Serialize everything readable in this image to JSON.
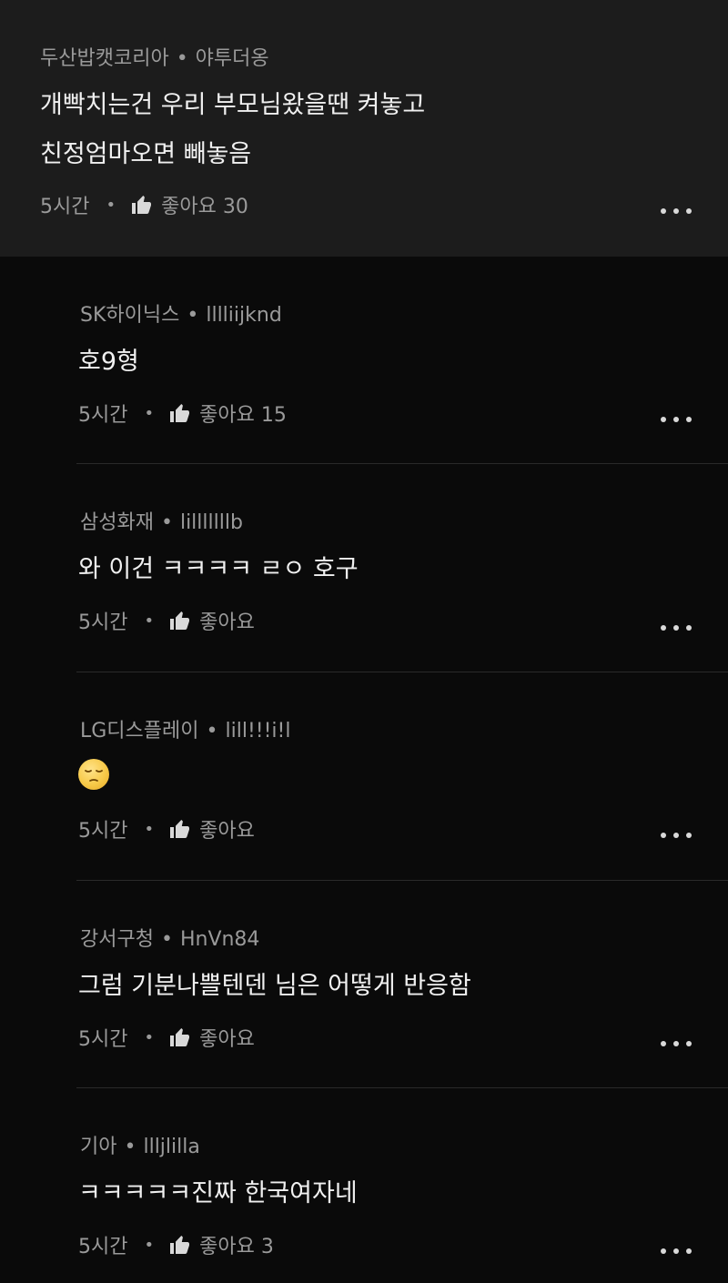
{
  "comments": [
    {
      "author": "두산밥캣코리아",
      "nickname": "야투더옹",
      "separator": "•",
      "lines": [
        "개빡치는건 우리 부모님왔을땐 켜놓고",
        "친정엄마오면 빼놓음"
      ],
      "time": "5시간",
      "footer_sep": "•",
      "like_label": "좋아요 30",
      "like_icon": "thumbs-up-icon",
      "more_icon": "more-dots-icon"
    }
  ],
  "replies": [
    {
      "author": "SK하이닉스",
      "nickname": "lllliijknd",
      "separator": "•",
      "text": "호9형",
      "time": "5시간",
      "footer_sep": "•",
      "like_label": "좋아요 15"
    },
    {
      "author": "삼성화재",
      "nickname": "lilllllllb",
      "separator": "•",
      "text": "와 이건 ㅋㅋㅋㅋ ㄹㅇ 호구",
      "time": "5시간",
      "footer_sep": "•",
      "like_label": "좋아요"
    },
    {
      "author": "LG디스플레이",
      "nickname": "lill!!!i!l",
      "separator": "•",
      "text": "",
      "emoji": "pensive-face-emoji",
      "time": "5시간",
      "footer_sep": "•",
      "like_label": "좋아요"
    },
    {
      "author": "강서구청",
      "nickname": "HnVn84",
      "separator": "•",
      "text": "그럼 기분나쁠텐덴 님은 어떻게 반응함",
      "time": "5시간",
      "footer_sep": "•",
      "like_label": "좋아요"
    },
    {
      "author": "기아",
      "nickname": "llljlilla",
      "separator": "•",
      "text": "ㅋㅋㅋㅋㅋ진짜 한국여자네",
      "time": "5시간",
      "footer_sep": "•",
      "like_label": "좋아요 3"
    }
  ],
  "colors": {
    "background": "#0a0a0a",
    "parent_background": "#1c1c1c",
    "meta_text": "#9a9a9a",
    "body_text": "#f0f0f0"
  }
}
